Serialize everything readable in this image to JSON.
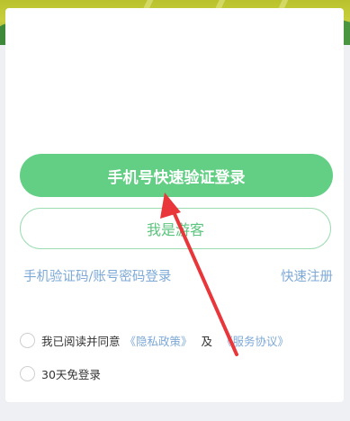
{
  "buttons": {
    "phone_login": "手机号快速验证登录",
    "guest": "我是游客"
  },
  "links": {
    "sms_password_login": "手机验证码/账号密码登录",
    "register": "快速注册"
  },
  "agreement": {
    "prefix": "我已阅读并同意",
    "privacy_policy": "《隐私政策》",
    "and": "及",
    "service_agreement": "《服务协议》"
  },
  "remember": {
    "label": "30天免登录"
  },
  "colors": {
    "primary_green": "#63cf84",
    "link_blue": "#7da9d6",
    "annotation_red": "#e8363a"
  },
  "icons": [
    "annotation-arrow-icon",
    "radio-icon"
  ]
}
